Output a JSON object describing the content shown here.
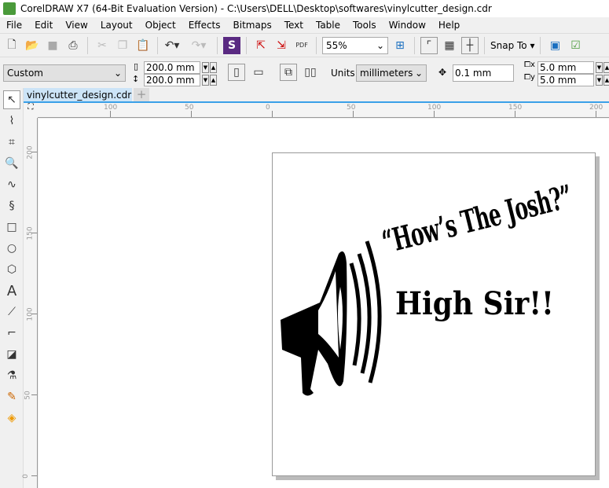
{
  "window": {
    "title": "CorelDRAW X7 (64-Bit Evaluation Version) - C:\\Users\\DELL\\Desktop\\softwares\\vinylcutter_design.cdr"
  },
  "menu": [
    "File",
    "Edit",
    "View",
    "Layout",
    "Object",
    "Effects",
    "Bitmaps",
    "Text",
    "Table",
    "Tools",
    "Window",
    "Help"
  ],
  "toolbar": {
    "zoom": "55%",
    "snap_to": "Snap To"
  },
  "property_bar": {
    "page_size": "Custom",
    "width": "200.0 mm",
    "height": "200.0 mm",
    "units_label": "Units:",
    "units": "millimeters",
    "nudge": "0.1 mm",
    "dup_x": "5.0 mm",
    "dup_y": "5.0 mm"
  },
  "document_tab": "vinylcutter_design.cdr",
  "rulers": {
    "horizontal": [
      "100",
      "50",
      "0",
      "50",
      "100",
      "150",
      "200"
    ],
    "vertical": [
      "200",
      "150",
      "100",
      "50",
      "0"
    ]
  },
  "design": {
    "line1": "“How’s The Josh?”",
    "line2": "High Sir!!"
  }
}
